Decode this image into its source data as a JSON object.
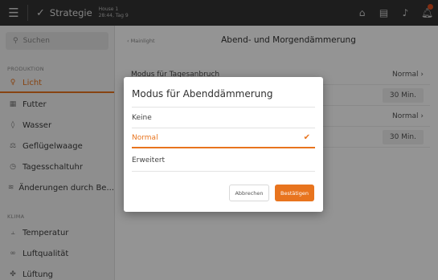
{
  "topbar": {
    "app_name": "Strategie",
    "house_name": "House 1",
    "house_time": "28:44, Tag 9",
    "icons": [
      "menu-icon",
      "strategy-logo-icon",
      "home-icon",
      "report-icon",
      "sound-icon",
      "alarm-icon"
    ]
  },
  "sidebar": {
    "search_placeholder": "Suchen",
    "section_production": "PRODUKTION",
    "section_climate": "KLIMA",
    "items": [
      {
        "label": "Licht",
        "icon": "bulb-icon",
        "active": true
      },
      {
        "label": "Futter",
        "icon": "feed-icon"
      },
      {
        "label": "Wasser",
        "icon": "drop-icon"
      },
      {
        "label": "Geflügelwaage",
        "icon": "scale-icon"
      },
      {
        "label": "Tagesschaltuhr",
        "icon": "clock-icon"
      },
      {
        "label": "Änderungen durch Be...",
        "icon": "wave-icon"
      },
      {
        "label": "Temperatur",
        "icon": "thermometer-icon"
      },
      {
        "label": "Luftqualität",
        "icon": "co2-icon"
      },
      {
        "label": "Lüftung",
        "icon": "fan-icon"
      }
    ]
  },
  "main": {
    "breadcrumb": "‹ Mainlight",
    "title": "Abend- und Morgendämmerung",
    "rows": [
      {
        "label": "Modus für Tagesanbruch",
        "value": "Normal ›"
      },
      {
        "label": "",
        "value": "30 Min."
      },
      {
        "label": "",
        "value": "Normal ›"
      },
      {
        "label": "",
        "value": "30 Min."
      }
    ]
  },
  "dialog": {
    "title": "Modus für Abenddämmerung",
    "options": [
      {
        "label": "Keine",
        "selected": false
      },
      {
        "label": "Normal",
        "selected": true
      },
      {
        "label": "Erweitert",
        "selected": false
      }
    ],
    "check_glyph": "✔",
    "cancel_label": "Abbrechen",
    "confirm_label": "Bestätigen"
  },
  "colors": {
    "accent": "#e8741e",
    "topbar": "#333333",
    "sidebar": "#f4f4f4"
  }
}
